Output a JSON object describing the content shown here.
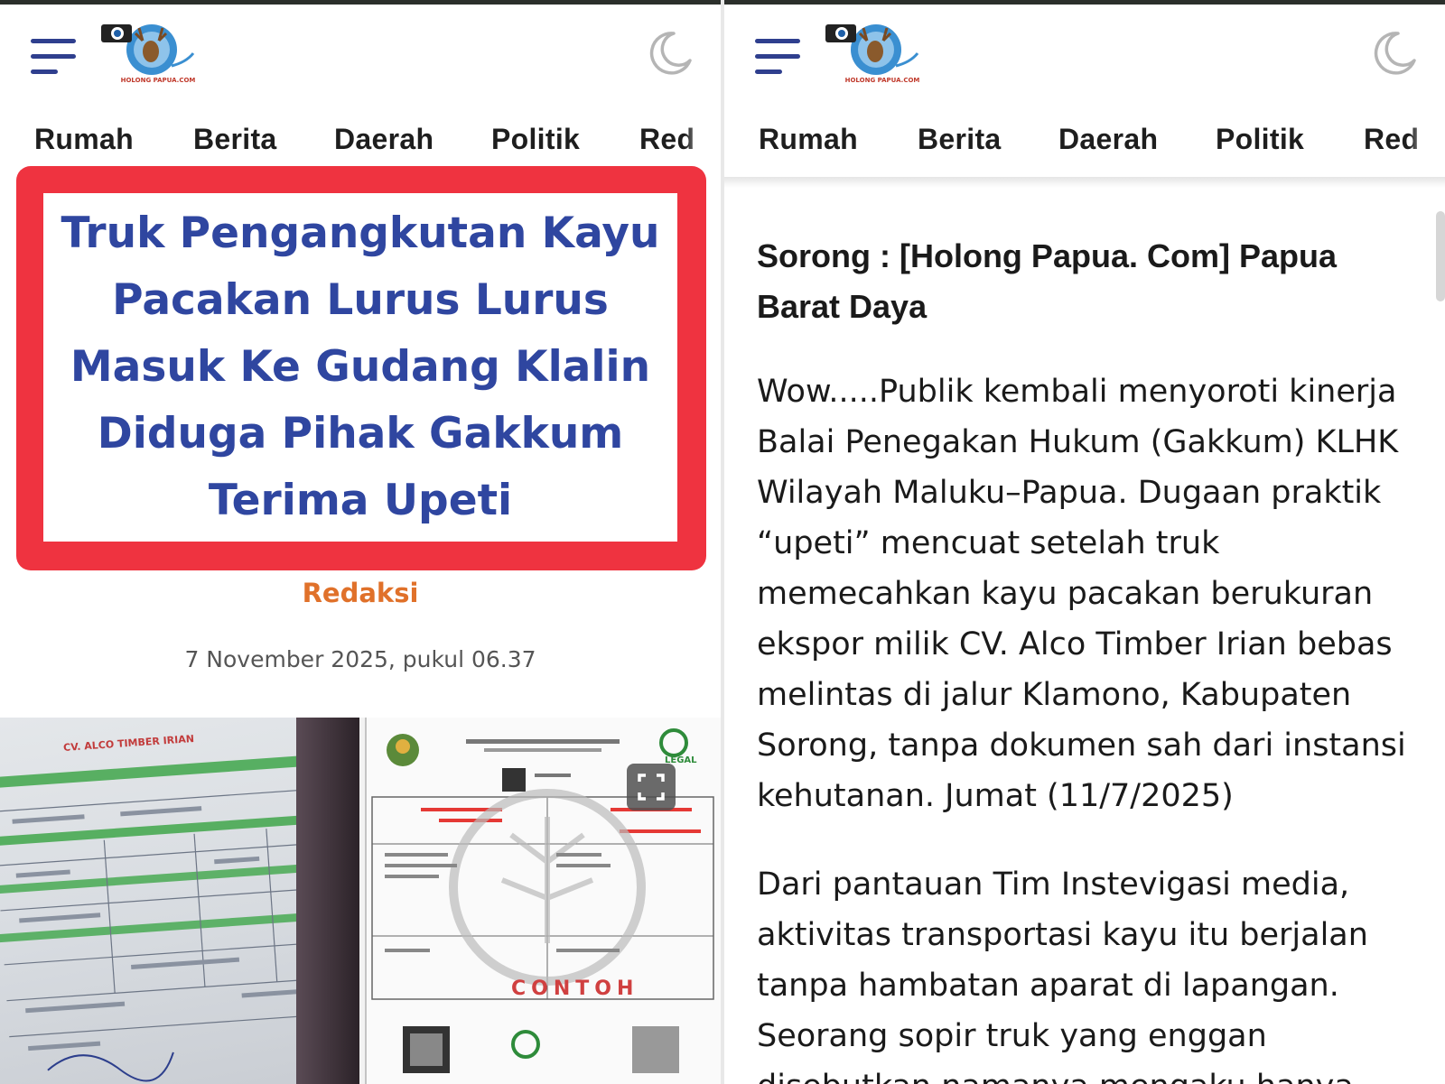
{
  "colors": {
    "accent_blue": "#2f46a0",
    "highlight_red": "#ef3340",
    "author_orange": "#e0712a"
  },
  "icons": {
    "menu": "hamburger-menu-icon",
    "theme": "moon-icon",
    "fullscreen": "expand-icon"
  },
  "site": {
    "logo_text": "HOLONG PAPUA.COM"
  },
  "nav": {
    "items": [
      "Rumah",
      "Berita",
      "Daerah",
      "Politik",
      "Red"
    ]
  },
  "left": {
    "title": "Truk Pengangkutan Kayu Pacakan Lurus Lurus Masuk Ke Gudang Klalin Diduga Pihak Gakkum Terima Upeti",
    "author": "Redaksi",
    "date": "7 November 2025, pukul 06.37",
    "image": {
      "doc_left_heading": "CV. ALCO TIMBER IRIAN",
      "doc_right_watermark": "CONTOH",
      "doc_right_badge": "LEGAL"
    }
  },
  "right": {
    "dateline": "Sorong : [Holong Papua. Com] Papua Barat Daya",
    "paragraph1": "Wow.....Publik kembali menyoroti kinerja Balai Penegakan Hukum (Gakkum) KLHK Wilayah Maluku–Papua. Dugaan praktik “upeti” mencuat setelah truk memecahkan kayu pacakan berukuran ekspor milik CV. Alco Timber Irian bebas melintas di jalur Klamono, Kabupaten Sorong, tanpa dokumen sah dari instansi kehutanan. Jumat (11/7/2025)",
    "paragraph2": "Dari pantauan Tim Instevigasi media, aktivitas transportasi kayu itu berjalan tanpa hambatan aparat di lapangan. Seorang sopir truk yang enggan disebutkan namanya mengaku hanya"
  }
}
